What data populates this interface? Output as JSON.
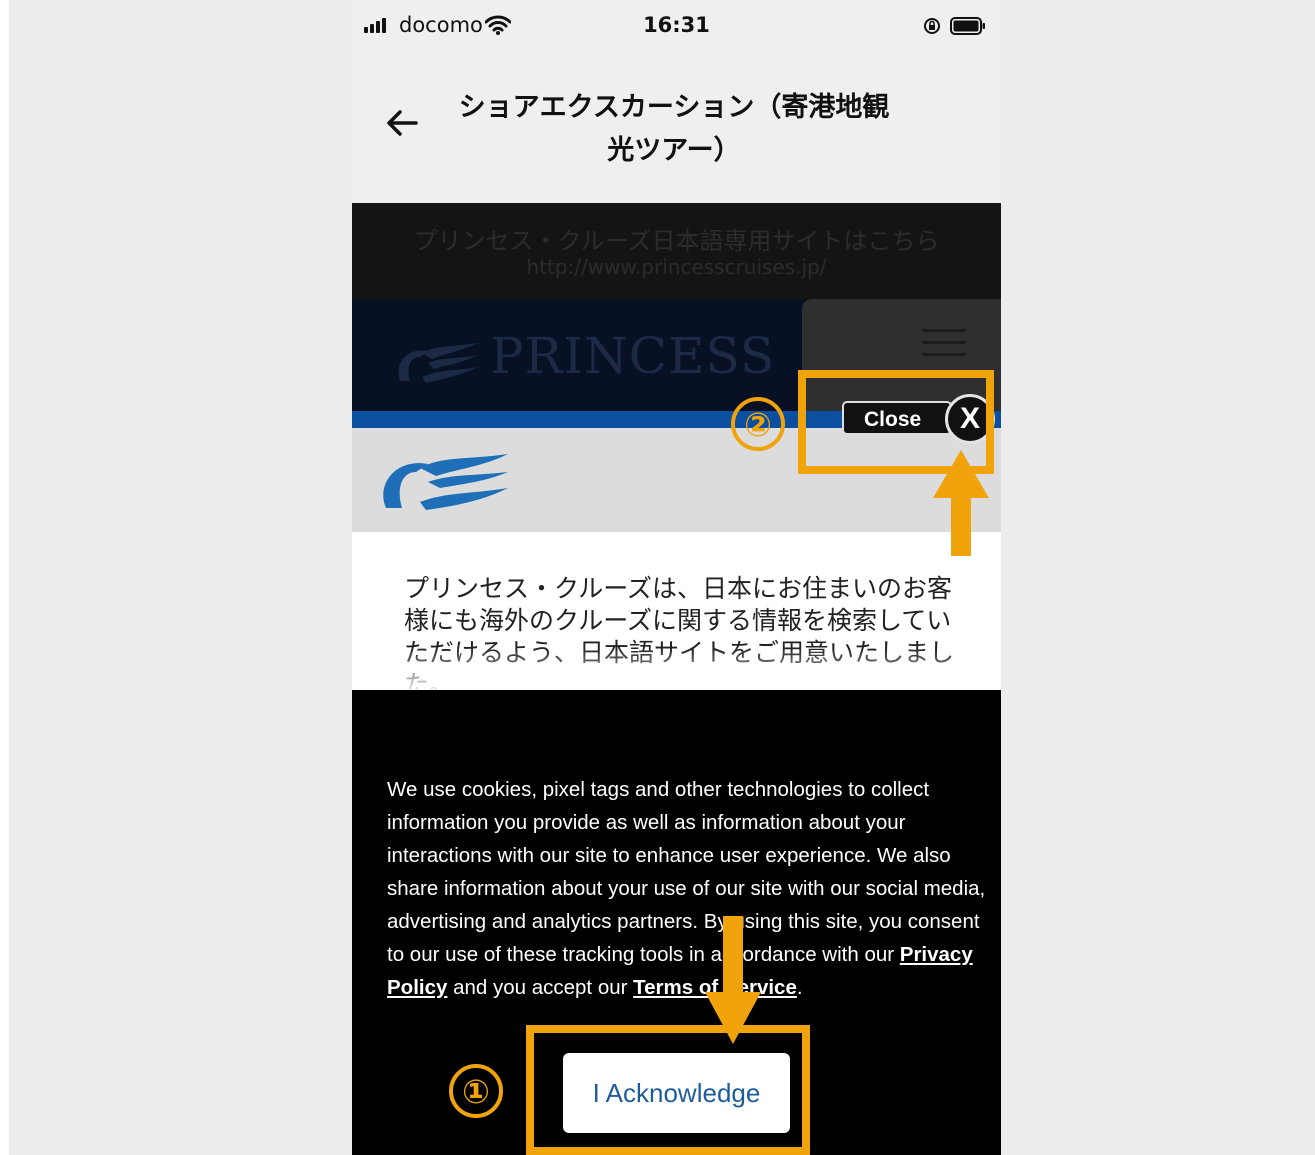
{
  "status_bar": {
    "carrier": "docomo",
    "time": "16:31"
  },
  "header": {
    "title_line1": "ショアエクスカーション（寄港地観",
    "title_line2": "光ツアー）"
  },
  "site": {
    "japanese_site_line1": "プリンセス・クルーズ日本語専用サイトはこちら",
    "japanese_site_line2": "http://www.princesscruises.jp/",
    "brand": "PRINCESS",
    "japanese_intro": "プリンセス・クルーズは、日本にお住まいのお客様にも海外のクルーズに関する情報を検索していただけるよう、日本語サイトをご用意いたしました。"
  },
  "close_popup": {
    "label": "Close",
    "x_label": "X"
  },
  "cookie_banner": {
    "text_before_privacy": "We use cookies, pixel tags and other technologies to collect information you provide as well as information about your interactions with our site to enhance user experience. We also share information about your use of our site with our social media, advertising and analytics partners. By using this site, you consent to our use of these tracking tools in accordance with our ",
    "privacy_link": "Privacy Policy",
    "text_middle": " and you accept our ",
    "terms_link": "Terms of Service",
    "text_end": ".",
    "acknowledge_button": "I Acknowledge"
  },
  "annotations": {
    "step1": "①",
    "step2": "②",
    "color": "#f0a30b"
  }
}
